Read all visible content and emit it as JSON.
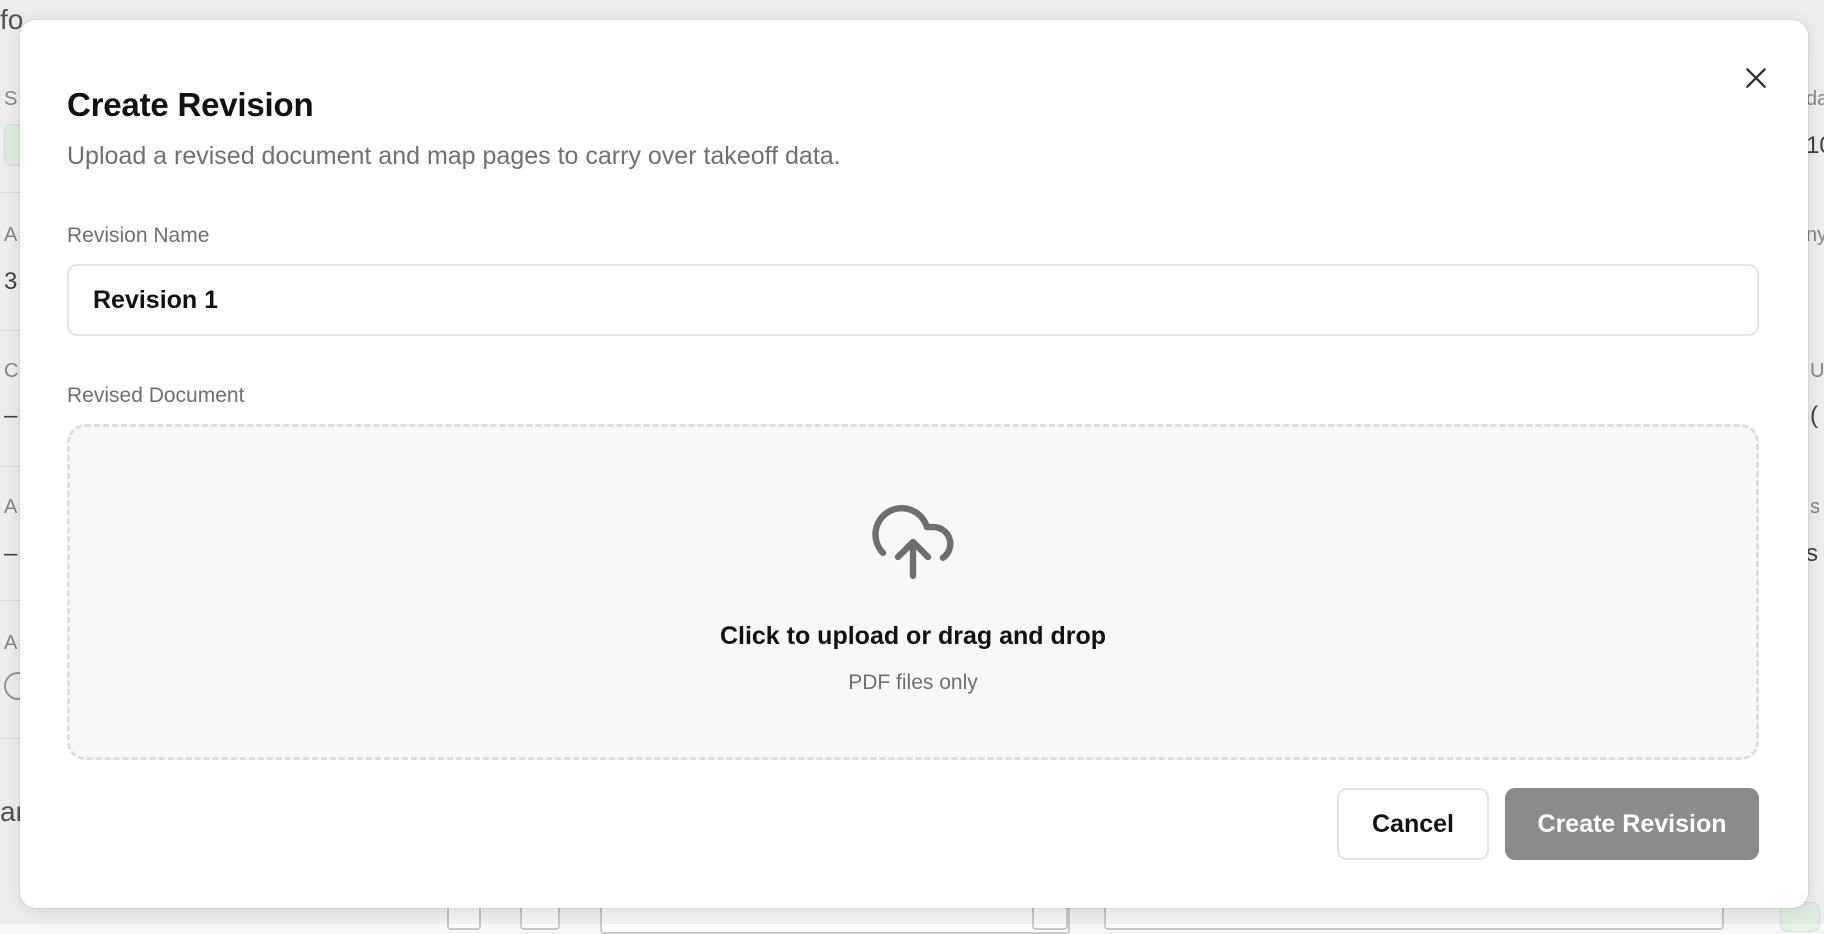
{
  "background": {
    "fragments": [
      "fo",
      "S",
      "A",
      "3",
      "C",
      "–",
      "A",
      "–",
      "A",
      "ar",
      "da",
      "10",
      "ny",
      "U",
      "(",
      "s",
      "s"
    ]
  },
  "modal": {
    "title": "Create Revision",
    "subtitle": "Upload a revised document and map pages to carry over takeoff data.",
    "close_icon": "close-icon",
    "fields": {
      "revision_name_label": "Revision Name",
      "revision_name_value": "Revision 1",
      "revised_document_label": "Revised Document"
    },
    "dropzone": {
      "icon": "cloud-upload-icon",
      "primary_text": "Click to upload or drag and drop",
      "secondary_text": "PDF files only"
    },
    "actions": {
      "cancel_label": "Cancel",
      "create_label": "Create Revision"
    }
  },
  "colors": {
    "primary_disabled": "#8c8c8c",
    "border": "#e5e5e5",
    "muted_text": "#707070"
  }
}
